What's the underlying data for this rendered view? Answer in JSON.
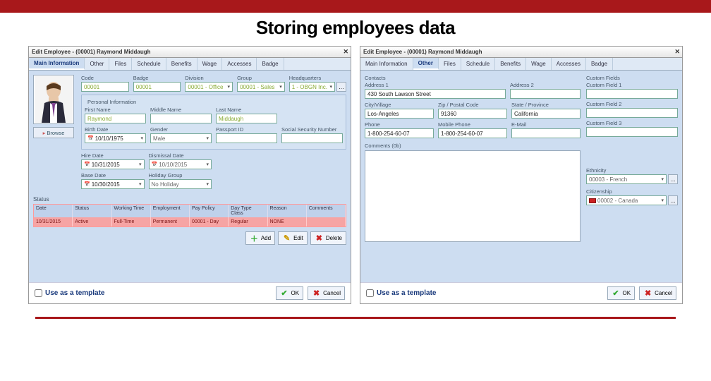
{
  "page_title": "Storing employees data",
  "left": {
    "window_title": "Edit Employee - (00001) Raymond Middaugh",
    "tabs": [
      "Main Information",
      "Other",
      "Files",
      "Schedule",
      "Benefits",
      "Wage",
      "Accesses",
      "Badge"
    ],
    "active_tab": 0,
    "codes": {
      "label": "Code",
      "value": "00001",
      "badge_label": "Badge",
      "badge_value": "00001",
      "division_label": "Division",
      "division_value": "00001 - Office",
      "group_label": "Group",
      "group_value": "00001 - Sales",
      "hq_label": "Headquarters",
      "hq_value": "1 - OBGN Inc."
    },
    "personal_section": "Personal Information",
    "first_name": {
      "label": "First Name",
      "value": "Raymond"
    },
    "middle_name": {
      "label": "Middle Name",
      "value": ""
    },
    "last_name": {
      "label": "Last Name",
      "value": "Middaugh"
    },
    "birth_date": {
      "label": "Birth Date",
      "value": "10/10/1975"
    },
    "gender": {
      "label": "Gender",
      "value": "Male"
    },
    "passport": {
      "label": "Passport ID",
      "value": ""
    },
    "ssn": {
      "label": "Social Security Number",
      "value": ""
    },
    "hire_date": {
      "label": "Hire Date",
      "value": "10/31/2015"
    },
    "dismiss_date": {
      "label": "Dismissal Date",
      "value": "10/10/2015"
    },
    "base_date": {
      "label": "Base Date",
      "value": "10/30/2015"
    },
    "holiday_group": {
      "label": "Holiday Group",
      "value": "No Holiday"
    },
    "browse": "Browse",
    "status_label": "Status",
    "table_headers": [
      "Date",
      "Status",
      "Working Time",
      "Employment",
      "Pay Policy",
      "Day Type Class",
      "Reason",
      "Comments"
    ],
    "table_row": [
      "10/31/2015",
      "Active",
      "Full-Time",
      "Permanent",
      "00001 - Day",
      "Regular",
      "NONE",
      ""
    ],
    "btn_add": "Add",
    "btn_edit": "Edit",
    "btn_delete": "Delete",
    "template_label": "Use as a template",
    "btn_ok": "OK",
    "btn_cancel": "Cancel"
  },
  "right": {
    "window_title": "Edit Employee - (00001) Raymond Middaugh",
    "tabs": [
      "Main Information",
      "Other",
      "Files",
      "Schedule",
      "Benefits",
      "Wage",
      "Accesses",
      "Badge"
    ],
    "active_tab": 1,
    "contacts_section": "Contacts",
    "addr1": {
      "label": "Address 1",
      "value": "430 South Lawson Street"
    },
    "addr2": {
      "label": "Address 2",
      "value": ""
    },
    "city": {
      "label": "City/Village",
      "value": "Los-Angeles"
    },
    "zip": {
      "label": "Zip / Postal Code",
      "value": "91360"
    },
    "state": {
      "label": "State / Province",
      "value": "California"
    },
    "phone": {
      "label": "Phone",
      "value": "1-800-254-60-07"
    },
    "mobile": {
      "label": "Mobile Phone",
      "value": "1-800-254-60-07"
    },
    "email": {
      "label": "E-Mail",
      "value": ""
    },
    "comments_label": "Comments (0b)",
    "custom_section": "Custom Fields",
    "cf1": "Custom Field 1",
    "cf2": "Custom Field 2",
    "cf3": "Custom Field 3",
    "ethnicity_label": "Ethnicity",
    "ethnicity_value": "00003 - French",
    "citizenship_label": "Citizenship",
    "citizenship_value": "00002 - Canada",
    "template_label": "Use as a template",
    "btn_ok": "OK",
    "btn_cancel": "Cancel"
  }
}
